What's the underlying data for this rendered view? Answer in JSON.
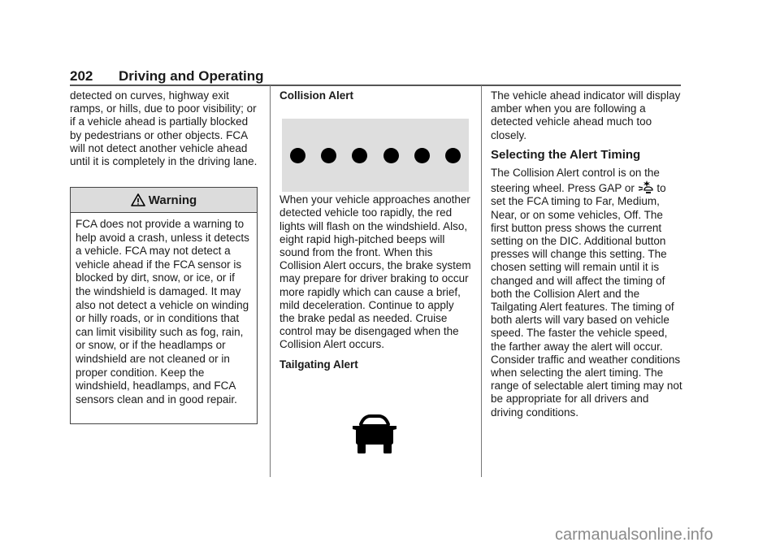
{
  "header": {
    "page_number": "202",
    "section_title": "Driving and Operating"
  },
  "column1": {
    "intro": "detected on curves, highway exit ramps, or hills, due to poor visibility; or if a vehicle ahead is partially blocked by pedestrians or other objects. FCA will not detect another vehicle ahead until it is completely in the driving lane.",
    "warning": {
      "icon": "warning-triangle-icon",
      "title": "Warning",
      "body": "FCA does not provide a warning to help avoid a crash, unless it detects a vehicle. FCA may not detect a vehicle ahead if the FCA sensor is blocked by dirt, snow, or ice, or if the windshield is damaged. It may also not detect a vehicle on winding or hilly roads, or in conditions that can limit visibility such as fog, rain, or snow, or if the headlamps or windshield are not cleaned or in proper condition. Keep the windshield, headlamps, and FCA sensors clean and in good repair."
    }
  },
  "column2": {
    "collision_heading": "Collision Alert",
    "collision_image": {
      "description": "row of flashing alert lights",
      "dot_count": 6
    },
    "collision_text": "When your vehicle approaches another detected vehicle too rapidly, the red lights will flash on the windshield. Also, eight rapid high-pitched beeps will sound from the front. When this Collision Alert occurs, the brake system may prepare for driver braking to occur more rapidly which can cause a brief, mild deceleration. Continue to apply the brake pedal as needed. Cruise control may be disengaged when the Collision Alert occurs.",
    "tailgating_heading": "Tailgating Alert",
    "tailgating_icon": "vehicle-ahead-icon"
  },
  "column3": {
    "intro": "The vehicle ahead indicator will display amber when you are following a detected vehicle ahead much too closely.",
    "heading": "Selecting the Alert Timing",
    "text_before_icon": "The Collision Alert control is on the steering wheel. Press GAP or",
    "inline_icon": "collision-alert-button-icon",
    "text_after_icon": "to set the FCA timing to Far, Medium, Near, or on some vehicles, Off. The first button press shows the current setting on the DIC. Additional button presses will change this setting. The chosen setting will remain until it is changed and will affect the timing of both the Collision Alert and the Tailgating Alert features. The timing of both alerts will vary based on vehicle speed. The faster the vehicle speed, the farther away the alert will occur. Consider traffic and weather conditions when selecting the alert timing. The range of selectable alert timing may not be appropriate for all drivers and driving conditions."
  },
  "watermark": "carmanualsonline.info"
}
